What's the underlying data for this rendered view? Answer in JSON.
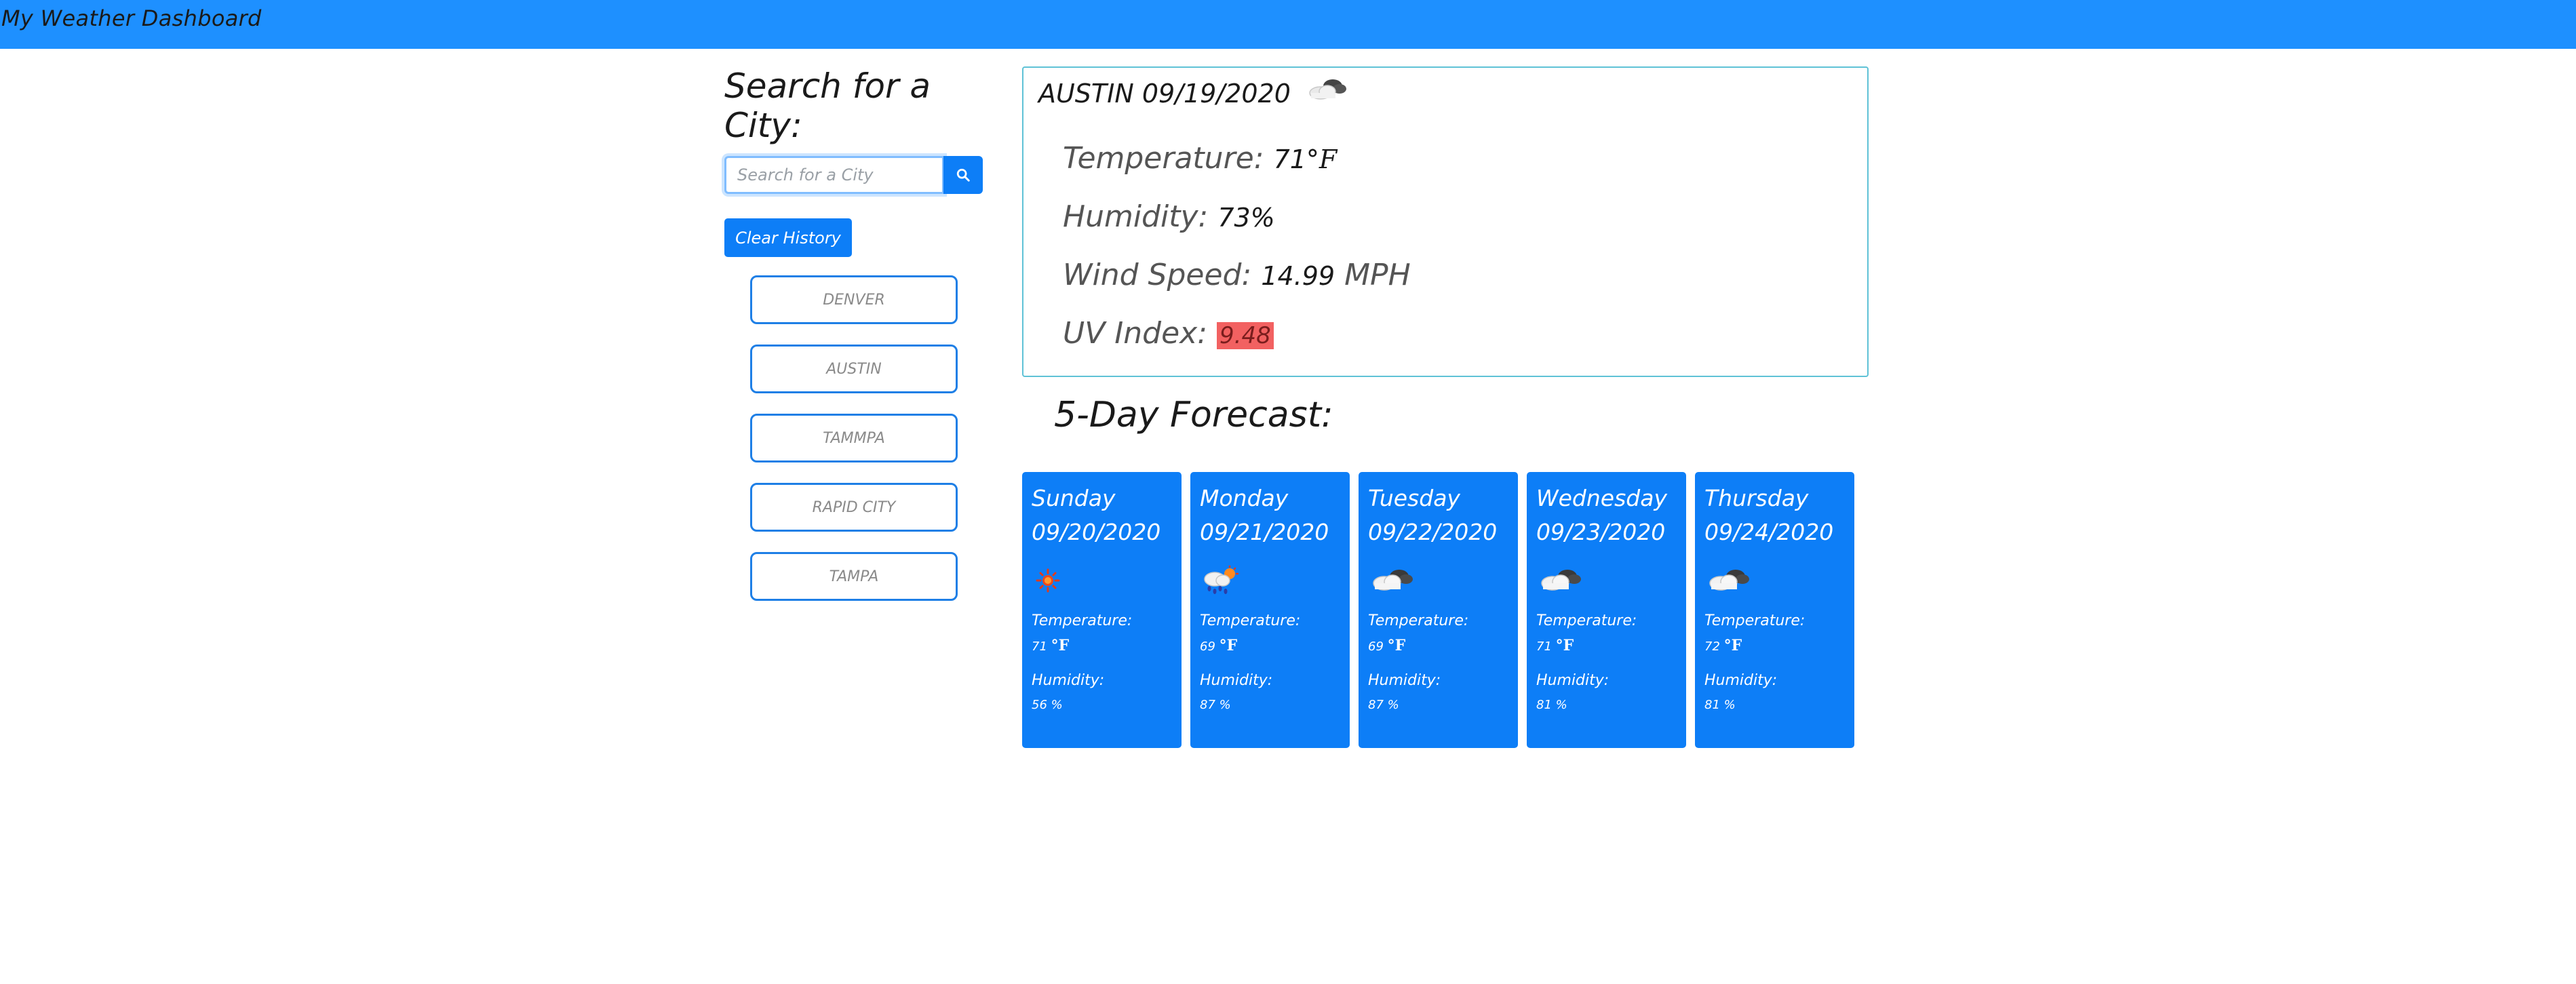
{
  "header": {
    "title": "My Weather Dashboard"
  },
  "search": {
    "heading": "Search for a City:",
    "placeholder": "Search for a City",
    "button_icon": "search-icon",
    "clear_label": "Clear History"
  },
  "history": [
    {
      "label": "DENVER"
    },
    {
      "label": "AUSTIN"
    },
    {
      "label": "TAMMPA"
    },
    {
      "label": "RAPID CITY"
    },
    {
      "label": "TAMPA"
    }
  ],
  "current": {
    "title": "AUSTIN 09/19/2020",
    "icon": "cloudy-icon",
    "temperature_label": "Temperature:",
    "temperature_value": "71",
    "temperature_unit": "°F",
    "humidity_label": "Humidity:",
    "humidity_value": "73%",
    "wind_label": "Wind Speed:",
    "wind_value": "14.99",
    "wind_unit": "MPH",
    "uv_label": "UV Index:",
    "uv_value": "9.48"
  },
  "forecast": {
    "heading": "5-Day Forecast:",
    "temperature_label": "Temperature:",
    "humidity_label": "Humidity:",
    "days": [
      {
        "day": "Sunday",
        "date": "09/20/2020",
        "icon": "sun-icon",
        "temp": "71",
        "unit": "°F",
        "humidity": "56 %"
      },
      {
        "day": "Monday",
        "date": "09/21/2020",
        "icon": "rain-sun-icon",
        "temp": "69",
        "unit": "°F",
        "humidity": "87 %"
      },
      {
        "day": "Tuesday",
        "date": "09/22/2020",
        "icon": "cloudy-icon",
        "temp": "69",
        "unit": "°F",
        "humidity": "87 %"
      },
      {
        "day": "Wednesday",
        "date": "09/23/2020",
        "icon": "cloudy-icon",
        "temp": "71",
        "unit": "°F",
        "humidity": "81 %"
      },
      {
        "day": "Thursday",
        "date": "09/24/2020",
        "icon": "cloudy-icon",
        "temp": "72",
        "unit": "°F",
        "humidity": "81 %"
      }
    ]
  },
  "colors": {
    "header": "#1e90ff",
    "primary": "#0d7ef7",
    "card_border": "#5fc2d6",
    "uv_high": "#f26161"
  }
}
